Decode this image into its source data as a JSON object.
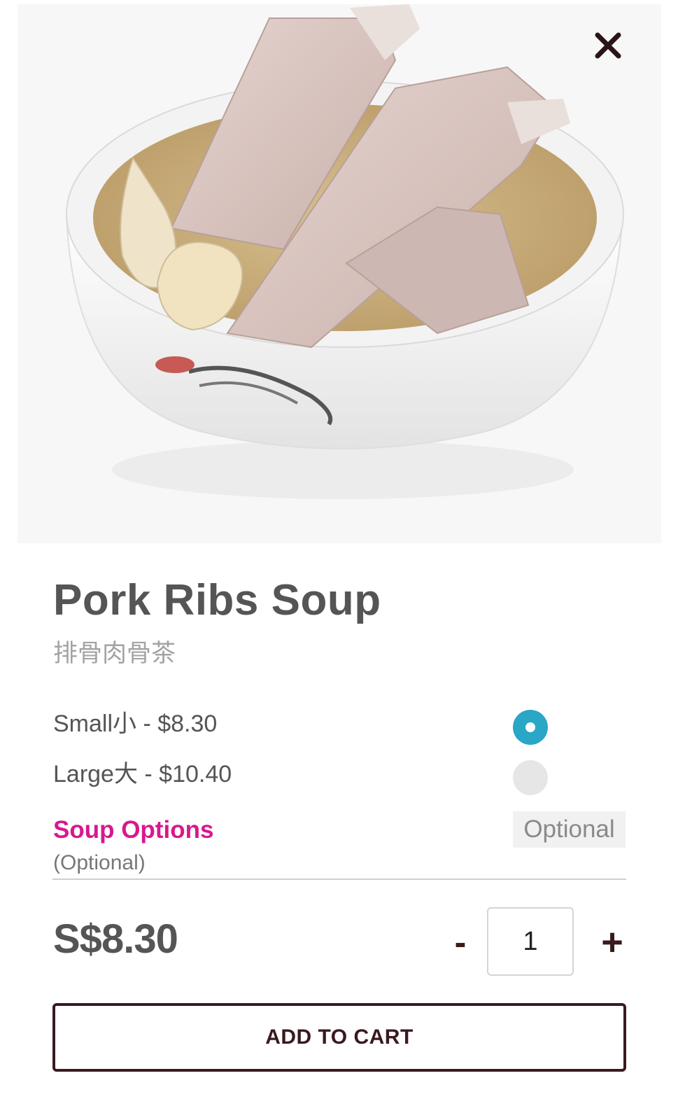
{
  "product": {
    "name": "Pork Ribs Soup",
    "name_chinese": "排骨肉骨茶",
    "image": "pork-ribs-soup-photo"
  },
  "sizes": [
    {
      "label": "Small小 - $8.30",
      "selected": true
    },
    {
      "label": "Large大 - $10.40",
      "selected": false
    }
  ],
  "soup_options": {
    "title": "Soup Options",
    "subtitle": "(Optional)",
    "badge": "Optional"
  },
  "total_price": "S$8.30",
  "quantity": {
    "minus_label": "-",
    "value": "1",
    "plus_label": "+"
  },
  "add_to_cart_label": "ADD TO CART",
  "icons": {
    "close": "close-icon"
  },
  "colors": {
    "accent_radio": "#2aa6c6",
    "section_title": "#d8188e",
    "button_border": "#3a1a1f"
  }
}
